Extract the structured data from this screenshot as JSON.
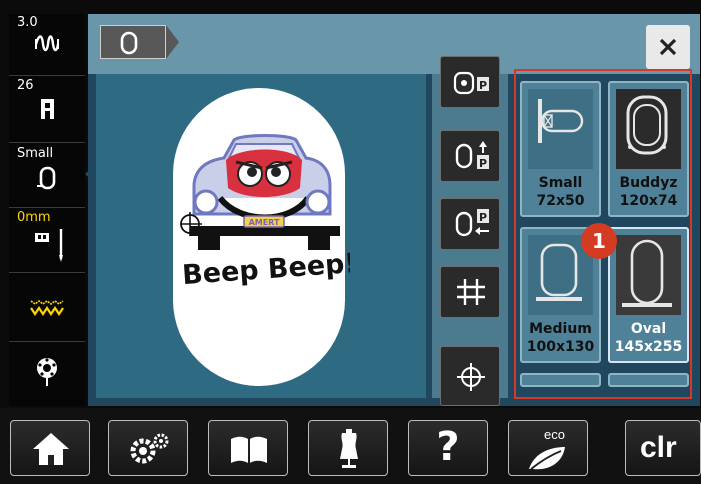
{
  "left_rail": {
    "items": [
      {
        "label": "3.0",
        "icon": "stitch-width-icon"
      },
      {
        "label": "26",
        "icon": "presser-foot-icon"
      },
      {
        "label": "Small",
        "icon": "hoop-icon"
      },
      {
        "label": "0mm",
        "icon": "needle-position-icon"
      },
      {
        "label": "",
        "icon": "feed-dog-icon"
      },
      {
        "label": "",
        "icon": "bobbin-icon"
      }
    ]
  },
  "top": {
    "tab_icon": "hoop-outline-icon",
    "close_icon": "close-icon"
  },
  "design_text": "Beep Beep!",
  "design_badge": "AMERT",
  "tools": [
    {
      "icon": "hoop-positions-icon"
    },
    {
      "icon": "hoop-park-up-icon"
    },
    {
      "icon": "hoop-park-back-icon"
    },
    {
      "icon": "grid-icon"
    },
    {
      "icon": "center-crosshair-icon"
    }
  ],
  "hoops": [
    {
      "name": "Small",
      "size": "72x50",
      "icon": "small-hoop-icon"
    },
    {
      "name": "Buddyz",
      "size": "120x74",
      "icon": "buddyz-hoop-icon"
    },
    {
      "name": "Medium",
      "size": "100x130",
      "icon": "medium-hoop-icon"
    },
    {
      "name": "Oval",
      "size": "145x255",
      "icon": "oval-hoop-icon"
    }
  ],
  "callout": "1",
  "bottom_bar": {
    "eco_label": "eco",
    "clr_label": "clr",
    "help_label": "?",
    "icons": [
      "home-icon",
      "settings-icon",
      "tutorial-book-icon",
      "dress-form-icon",
      "help-icon",
      "eco-leaf-icon",
      "clear-icon"
    ]
  },
  "colors": {
    "panel": "#20475d",
    "titlebar": "#6a96aa",
    "canvas": "#2f6a83",
    "highlight_frame": "#d8382a",
    "callout": "#d43b23",
    "rail_accent": "#ffd800"
  }
}
